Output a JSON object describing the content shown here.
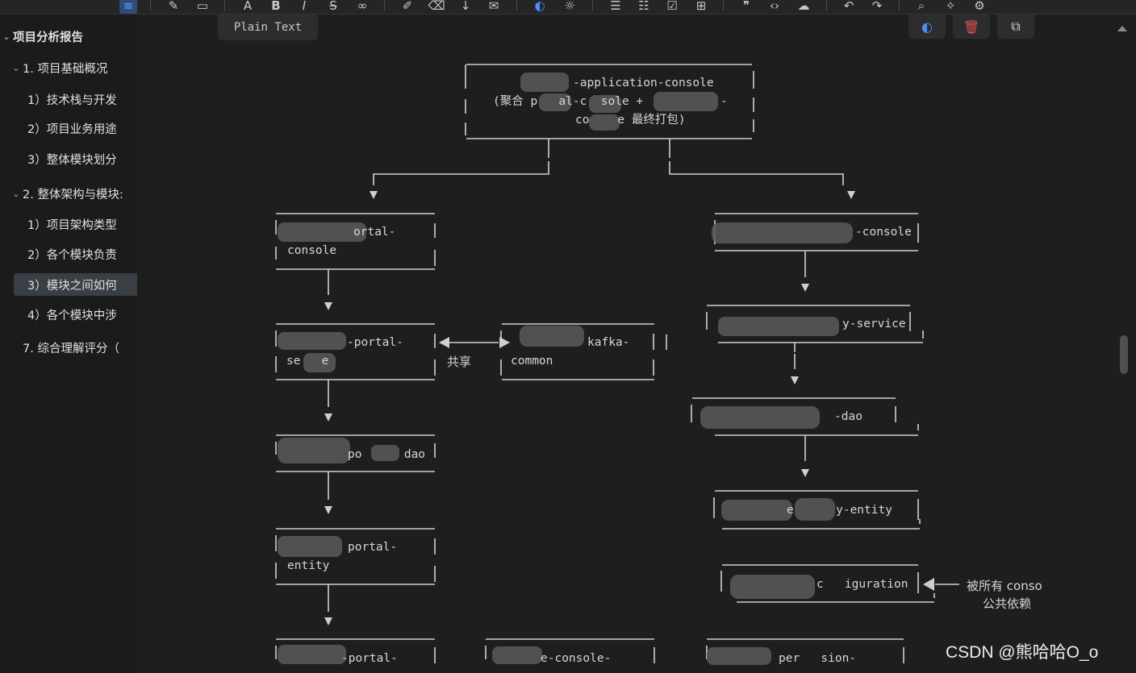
{
  "sidebar": {
    "items": [
      {
        "label": "项目分析报告",
        "level": 0,
        "expanded": true
      },
      {
        "label": "1. 项目基础概况",
        "level": 1,
        "expanded": true
      },
      {
        "label": "1）技术栈与开发",
        "level": 2
      },
      {
        "label": "2）项目业务用途",
        "level": 2
      },
      {
        "label": "3）整体模块划分",
        "level": 2
      },
      {
        "label": "2. 整体架构与模块:",
        "level": 1,
        "expanded": true
      },
      {
        "label": "1）项目架构类型",
        "level": 2
      },
      {
        "label": "2）各个模块负责",
        "level": 2
      },
      {
        "label": "3）模块之间如何",
        "level": 2,
        "active": true
      },
      {
        "label": "4）各个模块中涉",
        "level": 2
      },
      {
        "label": "7. 综合理解评分（",
        "level": 1
      }
    ]
  },
  "code_block": {
    "language_label": "Plain Text"
  },
  "diagram": {
    "nodes": {
      "app_console": [
        "-application-console",
        "(聚合 p   al-c  sole +           -",
        "co    e 最终打包)"
      ],
      "portal_console": [
        "ortal-",
        "console"
      ],
      "right_console": [
        "-console"
      ],
      "portal_service": [
        "-portal-",
        "se   e"
      ],
      "kafka_common": [
        "kafka-",
        "common"
      ],
      "right_service": [
        "y-service"
      ],
      "portal_dao": [
        "po      dao"
      ],
      "right_dao": [
        "-dao"
      ],
      "portal_entity": [
        "portal-",
        "entity"
      ],
      "right_entity": [
        "e      y-entity"
      ],
      "right_config": [
        "c   iguration"
      ],
      "bottom_portal": [
        "-portal-"
      ],
      "bottom_console": [
        "e-console-"
      ],
      "bottom_permission": [
        "per   sion-"
      ]
    },
    "annotations": {
      "share": "共享",
      "config_note_line1": "被所有 conso",
      "config_note_line2": "公共依赖"
    }
  },
  "watermark": "CSDN @熊哈哈O_o",
  "colors": {
    "background": "#1e1e1e",
    "sidebar": "#1b1b1b",
    "active_item": "#3a3f45",
    "line": "#cfcfcf",
    "accent_blue": "#4d8dff",
    "delete_red": "#e05050"
  }
}
